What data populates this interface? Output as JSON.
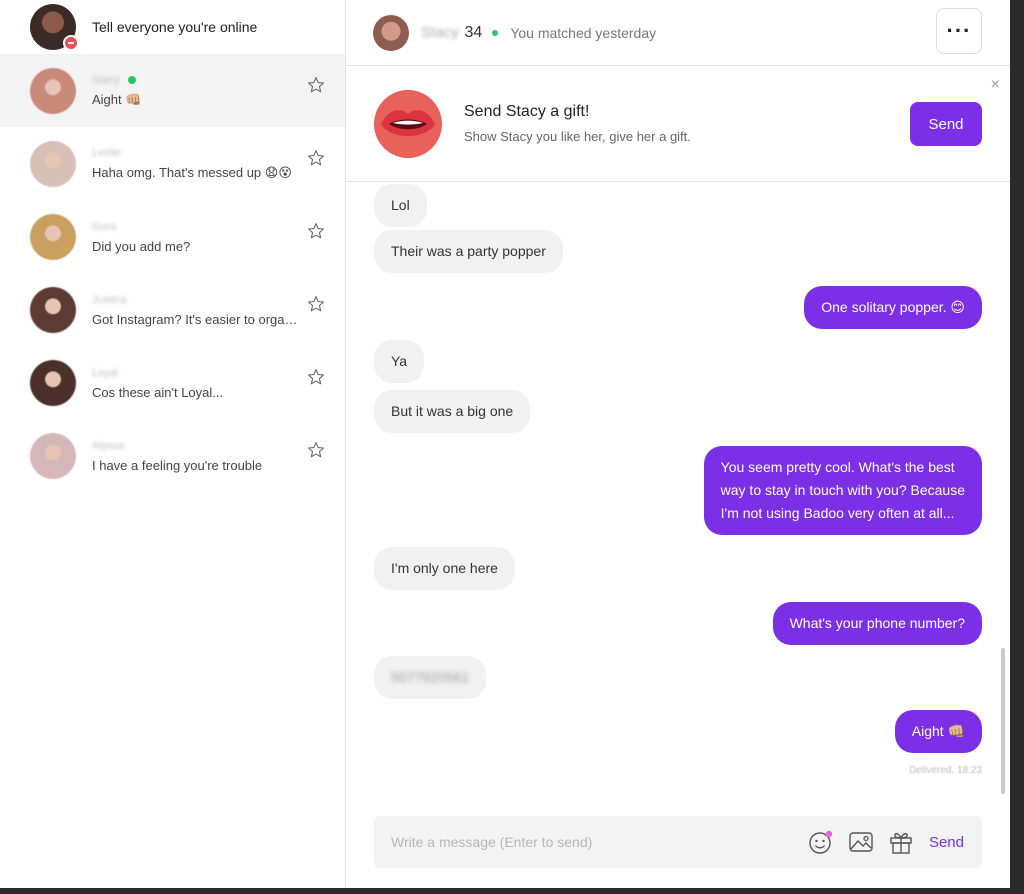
{
  "sidebar": {
    "top_text": "Tell everyone you're online",
    "conversations": [
      {
        "name": "Stacy",
        "message": "Aight 👊🏼",
        "online": true,
        "active": true,
        "avatar_color": "#c98a7c"
      },
      {
        "name": "Leslie",
        "message": "Haha omg. That's messed up 😧😵",
        "online": false,
        "active": false,
        "avatar_color": "#d9c0b6"
      },
      {
        "name": "Gora",
        "message": "Did you add me?",
        "online": false,
        "active": false,
        "avatar_color": "#c9a060"
      },
      {
        "name": "Justina",
        "message": "Got Instagram? It's easier to organi...",
        "online": false,
        "active": false,
        "avatar_color": "#5c3b34"
      },
      {
        "name": "Loyal",
        "message": "Cos these ain't Loyal...",
        "online": false,
        "active": false,
        "avatar_color": "#4a3028"
      },
      {
        "name": "Alyssa",
        "message": "I have a feeling you're trouble",
        "online": false,
        "active": false,
        "avatar_color": "#d6b7b9"
      }
    ]
  },
  "header": {
    "name": "Stacy",
    "age": "34",
    "subtitle": "You matched yesterday"
  },
  "gift": {
    "title": "Send Stacy a gift!",
    "subtitle": "Show Stacy you like her, give her a gift.",
    "button": "Send",
    "close": "×"
  },
  "messages": [
    {
      "dir": "in",
      "text": "Lol"
    },
    {
      "dir": "in",
      "text": "Their was a party popper"
    },
    {
      "dir": "out",
      "text": "One solitary popper. 😊"
    },
    {
      "dir": "in",
      "text": "Ya"
    },
    {
      "dir": "in",
      "text": "But it was a big one"
    },
    {
      "dir": "out",
      "text": "You seem pretty cool. What's the best\nway to stay in touch with you? Because\nI'm not using Badoo very often at all..."
    },
    {
      "dir": "in",
      "text": "I'm only one here"
    },
    {
      "dir": "out",
      "text": "What's your phone number?"
    },
    {
      "dir": "in",
      "text": "5077920561",
      "blurred": true
    },
    {
      "dir": "out",
      "text": "Aight 👊🏼"
    }
  ],
  "delivered": "Delivered, 18:23",
  "composer": {
    "placeholder": "Write a message (Enter to send)",
    "send": "Send",
    "icons": [
      "emoji-icon",
      "image-icon",
      "gift-icon"
    ]
  },
  "colors": {
    "accent": "#7b2fe6",
    "online": "#2ec46b",
    "bubble_in": "#f1f1f1"
  }
}
